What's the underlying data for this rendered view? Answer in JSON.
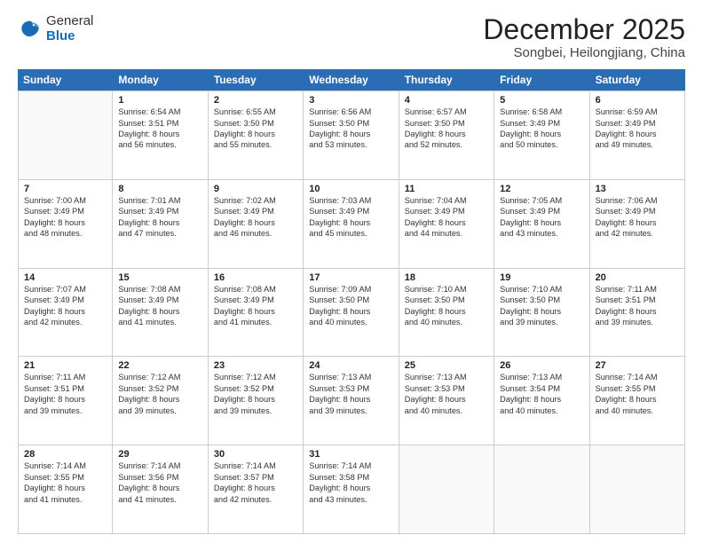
{
  "header": {
    "logo_general": "General",
    "logo_blue": "Blue",
    "title": "December 2025",
    "subtitle": "Songbei, Heilongjiang, China"
  },
  "days_of_week": [
    "Sunday",
    "Monday",
    "Tuesday",
    "Wednesday",
    "Thursday",
    "Friday",
    "Saturday"
  ],
  "weeks": [
    [
      {
        "day": "",
        "sunrise": "",
        "sunset": "",
        "daylight": "",
        "empty": true
      },
      {
        "day": "1",
        "sunrise": "Sunrise: 6:54 AM",
        "sunset": "Sunset: 3:51 PM",
        "daylight": "Daylight: 8 hours",
        "daylight2": "and 56 minutes."
      },
      {
        "day": "2",
        "sunrise": "Sunrise: 6:55 AM",
        "sunset": "Sunset: 3:50 PM",
        "daylight": "Daylight: 8 hours",
        "daylight2": "and 55 minutes."
      },
      {
        "day": "3",
        "sunrise": "Sunrise: 6:56 AM",
        "sunset": "Sunset: 3:50 PM",
        "daylight": "Daylight: 8 hours",
        "daylight2": "and 53 minutes."
      },
      {
        "day": "4",
        "sunrise": "Sunrise: 6:57 AM",
        "sunset": "Sunset: 3:50 PM",
        "daylight": "Daylight: 8 hours",
        "daylight2": "and 52 minutes."
      },
      {
        "day": "5",
        "sunrise": "Sunrise: 6:58 AM",
        "sunset": "Sunset: 3:49 PM",
        "daylight": "Daylight: 8 hours",
        "daylight2": "and 50 minutes."
      },
      {
        "day": "6",
        "sunrise": "Sunrise: 6:59 AM",
        "sunset": "Sunset: 3:49 PM",
        "daylight": "Daylight: 8 hours",
        "daylight2": "and 49 minutes."
      }
    ],
    [
      {
        "day": "7",
        "sunrise": "Sunrise: 7:00 AM",
        "sunset": "Sunset: 3:49 PM",
        "daylight": "Daylight: 8 hours",
        "daylight2": "and 48 minutes."
      },
      {
        "day": "8",
        "sunrise": "Sunrise: 7:01 AM",
        "sunset": "Sunset: 3:49 PM",
        "daylight": "Daylight: 8 hours",
        "daylight2": "and 47 minutes."
      },
      {
        "day": "9",
        "sunrise": "Sunrise: 7:02 AM",
        "sunset": "Sunset: 3:49 PM",
        "daylight": "Daylight: 8 hours",
        "daylight2": "and 46 minutes."
      },
      {
        "day": "10",
        "sunrise": "Sunrise: 7:03 AM",
        "sunset": "Sunset: 3:49 PM",
        "daylight": "Daylight: 8 hours",
        "daylight2": "and 45 minutes."
      },
      {
        "day": "11",
        "sunrise": "Sunrise: 7:04 AM",
        "sunset": "Sunset: 3:49 PM",
        "daylight": "Daylight: 8 hours",
        "daylight2": "and 44 minutes."
      },
      {
        "day": "12",
        "sunrise": "Sunrise: 7:05 AM",
        "sunset": "Sunset: 3:49 PM",
        "daylight": "Daylight: 8 hours",
        "daylight2": "and 43 minutes."
      },
      {
        "day": "13",
        "sunrise": "Sunrise: 7:06 AM",
        "sunset": "Sunset: 3:49 PM",
        "daylight": "Daylight: 8 hours",
        "daylight2": "and 42 minutes."
      }
    ],
    [
      {
        "day": "14",
        "sunrise": "Sunrise: 7:07 AM",
        "sunset": "Sunset: 3:49 PM",
        "daylight": "Daylight: 8 hours",
        "daylight2": "and 42 minutes."
      },
      {
        "day": "15",
        "sunrise": "Sunrise: 7:08 AM",
        "sunset": "Sunset: 3:49 PM",
        "daylight": "Daylight: 8 hours",
        "daylight2": "and 41 minutes."
      },
      {
        "day": "16",
        "sunrise": "Sunrise: 7:08 AM",
        "sunset": "Sunset: 3:49 PM",
        "daylight": "Daylight: 8 hours",
        "daylight2": "and 41 minutes."
      },
      {
        "day": "17",
        "sunrise": "Sunrise: 7:09 AM",
        "sunset": "Sunset: 3:50 PM",
        "daylight": "Daylight: 8 hours",
        "daylight2": "and 40 minutes."
      },
      {
        "day": "18",
        "sunrise": "Sunrise: 7:10 AM",
        "sunset": "Sunset: 3:50 PM",
        "daylight": "Daylight: 8 hours",
        "daylight2": "and 40 minutes."
      },
      {
        "day": "19",
        "sunrise": "Sunrise: 7:10 AM",
        "sunset": "Sunset: 3:50 PM",
        "daylight": "Daylight: 8 hours",
        "daylight2": "and 39 minutes."
      },
      {
        "day": "20",
        "sunrise": "Sunrise: 7:11 AM",
        "sunset": "Sunset: 3:51 PM",
        "daylight": "Daylight: 8 hours",
        "daylight2": "and 39 minutes."
      }
    ],
    [
      {
        "day": "21",
        "sunrise": "Sunrise: 7:11 AM",
        "sunset": "Sunset: 3:51 PM",
        "daylight": "Daylight: 8 hours",
        "daylight2": "and 39 minutes."
      },
      {
        "day": "22",
        "sunrise": "Sunrise: 7:12 AM",
        "sunset": "Sunset: 3:52 PM",
        "daylight": "Daylight: 8 hours",
        "daylight2": "and 39 minutes."
      },
      {
        "day": "23",
        "sunrise": "Sunrise: 7:12 AM",
        "sunset": "Sunset: 3:52 PM",
        "daylight": "Daylight: 8 hours",
        "daylight2": "and 39 minutes."
      },
      {
        "day": "24",
        "sunrise": "Sunrise: 7:13 AM",
        "sunset": "Sunset: 3:53 PM",
        "daylight": "Daylight: 8 hours",
        "daylight2": "and 39 minutes."
      },
      {
        "day": "25",
        "sunrise": "Sunrise: 7:13 AM",
        "sunset": "Sunset: 3:53 PM",
        "daylight": "Daylight: 8 hours",
        "daylight2": "and 40 minutes."
      },
      {
        "day": "26",
        "sunrise": "Sunrise: 7:13 AM",
        "sunset": "Sunset: 3:54 PM",
        "daylight": "Daylight: 8 hours",
        "daylight2": "and 40 minutes."
      },
      {
        "day": "27",
        "sunrise": "Sunrise: 7:14 AM",
        "sunset": "Sunset: 3:55 PM",
        "daylight": "Daylight: 8 hours",
        "daylight2": "and 40 minutes."
      }
    ],
    [
      {
        "day": "28",
        "sunrise": "Sunrise: 7:14 AM",
        "sunset": "Sunset: 3:55 PM",
        "daylight": "Daylight: 8 hours",
        "daylight2": "and 41 minutes."
      },
      {
        "day": "29",
        "sunrise": "Sunrise: 7:14 AM",
        "sunset": "Sunset: 3:56 PM",
        "daylight": "Daylight: 8 hours",
        "daylight2": "and 41 minutes."
      },
      {
        "day": "30",
        "sunrise": "Sunrise: 7:14 AM",
        "sunset": "Sunset: 3:57 PM",
        "daylight": "Daylight: 8 hours",
        "daylight2": "and 42 minutes."
      },
      {
        "day": "31",
        "sunrise": "Sunrise: 7:14 AM",
        "sunset": "Sunset: 3:58 PM",
        "daylight": "Daylight: 8 hours",
        "daylight2": "and 43 minutes."
      },
      {
        "day": "",
        "sunrise": "",
        "sunset": "",
        "daylight": "",
        "daylight2": "",
        "empty": true
      },
      {
        "day": "",
        "sunrise": "",
        "sunset": "",
        "daylight": "",
        "daylight2": "",
        "empty": true
      },
      {
        "day": "",
        "sunrise": "",
        "sunset": "",
        "daylight": "",
        "daylight2": "",
        "empty": true
      }
    ]
  ]
}
